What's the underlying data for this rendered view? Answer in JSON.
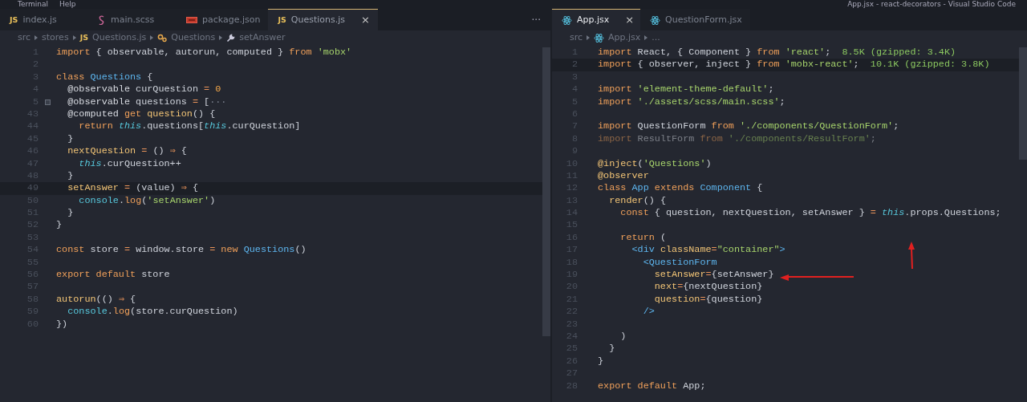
{
  "title_bar": {
    "menu": [
      "Terminal",
      "Help"
    ],
    "title": "App.jsx - react-decorators - Visual Studio Code"
  },
  "panes": [
    {
      "tabs": [
        {
          "label": "index.js",
          "kind": "js",
          "icon_text": "JS",
          "selected": false
        },
        {
          "label": "main.scss",
          "kind": "scss",
          "selected": false
        },
        {
          "label": "package.json",
          "kind": "json",
          "selected": false
        },
        {
          "label": "Questions.js",
          "kind": "js",
          "icon_text": "JS",
          "selected": true,
          "close": "×"
        }
      ],
      "more": "···",
      "breadcrumb": [
        {
          "label": "src"
        },
        {
          "label": "stores"
        },
        {
          "label": "Questions.js",
          "kind": "js",
          "icon_text": "JS"
        },
        {
          "label": "Questions",
          "kind": "class"
        },
        {
          "label": "setAnswer",
          "kind": "method"
        }
      ],
      "lines": [
        {
          "num": "1",
          "tokens": [
            {
              "text": "import",
              "kind": "k"
            },
            {
              "text": " { observable, autorun, computed } ",
              "kind": "v"
            },
            {
              "text": "from",
              "kind": "k"
            },
            {
              "text": " 'mobx'",
              "kind": "s"
            }
          ]
        },
        {
          "num": "2"
        },
        {
          "num": "3",
          "tokens": [
            {
              "text": "class",
              "kind": "k"
            },
            {
              "text": " Questions",
              "kind": "c"
            },
            {
              "text": " {",
              "kind": "v"
            }
          ]
        },
        {
          "num": "4",
          "tokens": [
            {
              "text": "  @observable",
              "kind": "d"
            },
            {
              "text": " curQuestion ",
              "kind": "v"
            },
            {
              "text": "=",
              "kind": "o"
            },
            {
              "text": " 0",
              "kind": "n"
            }
          ]
        },
        {
          "num": "5",
          "folded": true,
          "tokens": [
            {
              "text": "  @observable",
              "kind": "d"
            },
            {
              "text": " questions ",
              "kind": "v"
            },
            {
              "text": "=",
              "kind": "o"
            },
            {
              "text": " [",
              "kind": "v"
            },
            {
              "text": "···",
              "kind": "x"
            }
          ]
        },
        {
          "num": "43",
          "tokens": [
            {
              "text": "  @computed",
              "kind": "d"
            },
            {
              "text": " get",
              "kind": "k"
            },
            {
              "text": " question",
              "kind": "f"
            },
            {
              "text": "() {",
              "kind": "v"
            }
          ]
        },
        {
          "num": "44",
          "tokens": [
            {
              "text": "    return",
              "kind": "k"
            },
            {
              "text": " this",
              "kind": "t"
            },
            {
              "text": ".questions[",
              "kind": "v"
            },
            {
              "text": "this",
              "kind": "t"
            },
            {
              "text": ".curQuestion]",
              "kind": "v"
            }
          ]
        },
        {
          "num": "45",
          "tokens": [
            {
              "text": "  }",
              "kind": "v"
            }
          ]
        },
        {
          "num": "46",
          "tokens": [
            {
              "text": "  nextQuestion",
              "kind": "f"
            },
            {
              "text": " =",
              "kind": "o"
            },
            {
              "text": " () ",
              "kind": "v"
            },
            {
              "text": "⇒",
              "kind": "o"
            },
            {
              "text": " {",
              "kind": "v"
            }
          ]
        },
        {
          "num": "47",
          "tokens": [
            {
              "text": "    this",
              "kind": "t"
            },
            {
              "text": ".curQuestion++",
              "kind": "v"
            }
          ]
        },
        {
          "num": "48",
          "tokens": [
            {
              "text": "  }",
              "kind": "v"
            }
          ]
        },
        {
          "num": "49",
          "current": true,
          "tokens": [
            {
              "text": "  setAnswer",
              "kind": "f"
            },
            {
              "text": " =",
              "kind": "o"
            },
            {
              "text": " (value) ",
              "kind": "v"
            },
            {
              "text": "⇒",
              "kind": "o"
            },
            {
              "text": " {",
              "kind": "v"
            }
          ]
        },
        {
          "num": "50",
          "tokens": [
            {
              "text": "    console",
              "kind": "b"
            },
            {
              "text": ".",
              "kind": "v"
            },
            {
              "text": "log",
              "kind": "k"
            },
            {
              "text": "(",
              "kind": "v"
            },
            {
              "text": "'setAnswer'",
              "kind": "s"
            },
            {
              "text": ")",
              "kind": "v"
            }
          ]
        },
        {
          "num": "51",
          "tokens": [
            {
              "text": "  }",
              "kind": "v"
            }
          ]
        },
        {
          "num": "52",
          "tokens": [
            {
              "text": "}",
              "kind": "v"
            }
          ]
        },
        {
          "num": "53"
        },
        {
          "num": "54",
          "tokens": [
            {
              "text": "const",
              "kind": "k"
            },
            {
              "text": " store ",
              "kind": "v"
            },
            {
              "text": "=",
              "kind": "o"
            },
            {
              "text": " window.store ",
              "kind": "v"
            },
            {
              "text": "=",
              "kind": "o"
            },
            {
              "text": " new",
              "kind": "k"
            },
            {
              "text": " Questions",
              "kind": "c"
            },
            {
              "text": "()",
              "kind": "v"
            }
          ]
        },
        {
          "num": "55"
        },
        {
          "num": "56",
          "tokens": [
            {
              "text": "export default",
              "kind": "k"
            },
            {
              "text": " store",
              "kind": "v"
            }
          ]
        },
        {
          "num": "57"
        },
        {
          "num": "58",
          "tokens": [
            {
              "text": "autorun",
              "kind": "f"
            },
            {
              "text": "(() ",
              "kind": "v"
            },
            {
              "text": "⇒",
              "kind": "o"
            },
            {
              "text": " {",
              "kind": "v"
            }
          ]
        },
        {
          "num": "59",
          "tokens": [
            {
              "text": "  console",
              "kind": "b"
            },
            {
              "text": ".",
              "kind": "v"
            },
            {
              "text": "log",
              "kind": "k"
            },
            {
              "text": "(store.curQuestion)",
              "kind": "v"
            }
          ]
        },
        {
          "num": "60",
          "tokens": [
            {
              "text": "})",
              "kind": "v"
            }
          ]
        }
      ]
    },
    {
      "tabs": [
        {
          "label": "App.jsx",
          "kind": "react",
          "selected": true,
          "close": "×"
        },
        {
          "label": "QuestionForm.jsx",
          "kind": "react",
          "selected": false
        }
      ],
      "breadcrumb": [
        {
          "label": "src"
        },
        {
          "label": "App.jsx",
          "kind": "react"
        },
        {
          "label": "..."
        }
      ],
      "lines": [
        {
          "num": "1",
          "tokens": [
            {
              "text": "import",
              "kind": "k"
            },
            {
              "text": " React, { Component } ",
              "kind": "v"
            },
            {
              "text": "from",
              "kind": "k"
            },
            {
              "text": " 'react'",
              "kind": "s"
            },
            {
              "text": ";",
              "kind": "v"
            },
            {
              "text": "  8.5K (gzipped: 3.4K)",
              "kind": "g"
            }
          ]
        },
        {
          "num": "2",
          "current": true,
          "tokens": [
            {
              "text": "import",
              "kind": "k"
            },
            {
              "text": " { observer, inject } ",
              "kind": "v"
            },
            {
              "text": "from",
              "kind": "k"
            },
            {
              "text": " 'mobx-react'",
              "kind": "s"
            },
            {
              "text": ";",
              "kind": "v"
            },
            {
              "text": "  10.1K (gzipped: 3.8K)",
              "kind": "g"
            }
          ]
        },
        {
          "num": "3"
        },
        {
          "num": "4",
          "tokens": [
            {
              "text": "import",
              "kind": "k"
            },
            {
              "text": " 'element-theme-default'",
              "kind": "s"
            },
            {
              "text": ";",
              "kind": "v"
            }
          ]
        },
        {
          "num": "5",
          "tokens": [
            {
              "text": "import",
              "kind": "k"
            },
            {
              "text": " './assets/scss/main.scss'",
              "kind": "s"
            },
            {
              "text": ";",
              "kind": "v"
            }
          ]
        },
        {
          "num": "6"
        },
        {
          "num": "7",
          "tokens": [
            {
              "text": "import",
              "kind": "k"
            },
            {
              "text": " QuestionForm ",
              "kind": "v"
            },
            {
              "text": "from",
              "kind": "k"
            },
            {
              "text": " './components/QuestionForm'",
              "kind": "s"
            },
            {
              "text": ";",
              "kind": "v"
            }
          ]
        },
        {
          "num": "8",
          "dim": true,
          "tokens": [
            {
              "text": "import",
              "kind": "k"
            },
            {
              "text": " ResultForm ",
              "kind": "v"
            },
            {
              "text": "from",
              "kind": "k"
            },
            {
              "text": " './components/ResultForm'",
              "kind": "s"
            },
            {
              "text": ";",
              "kind": "v"
            }
          ]
        },
        {
          "num": "9"
        },
        {
          "num": "10",
          "tokens": [
            {
              "text": "@inject",
              "kind": "f"
            },
            {
              "text": "(",
              "kind": "v"
            },
            {
              "text": "'Questions'",
              "kind": "s"
            },
            {
              "text": ")",
              "kind": "v"
            }
          ]
        },
        {
          "num": "11",
          "tokens": [
            {
              "text": "@observer",
              "kind": "f"
            }
          ]
        },
        {
          "num": "12",
          "tokens": [
            {
              "text": "class",
              "kind": "k"
            },
            {
              "text": " App",
              "kind": "c"
            },
            {
              "text": " extends",
              "kind": "k"
            },
            {
              "text": " Component",
              "kind": "c"
            },
            {
              "text": " {",
              "kind": "v"
            }
          ]
        },
        {
          "num": "13",
          "tokens": [
            {
              "text": "  render",
              "kind": "f"
            },
            {
              "text": "() {",
              "kind": "v"
            }
          ]
        },
        {
          "num": "14",
          "tokens": [
            {
              "text": "    const",
              "kind": "k"
            },
            {
              "text": " { question, nextQuestion, setAnswer } ",
              "kind": "v"
            },
            {
              "text": "=",
              "kind": "o"
            },
            {
              "text": " this",
              "kind": "t"
            },
            {
              "text": ".props.Questions;",
              "kind": "v"
            }
          ]
        },
        {
          "num": "15"
        },
        {
          "num": "16",
          "tokens": [
            {
              "text": "    return",
              "kind": "k"
            },
            {
              "text": " (",
              "kind": "v"
            }
          ]
        },
        {
          "num": "17",
          "tokens": [
            {
              "text": "      <div",
              "kind": "c"
            },
            {
              "text": " className",
              "kind": "f"
            },
            {
              "text": "=",
              "kind": "o"
            },
            {
              "text": "\"container\"",
              "kind": "s"
            },
            {
              "text": ">",
              "kind": "c"
            }
          ]
        },
        {
          "num": "18",
          "tokens": [
            {
              "text": "        <QuestionForm",
              "kind": "c"
            }
          ]
        },
        {
          "num": "19",
          "tokens": [
            {
              "text": "          setAnswer",
              "kind": "f"
            },
            {
              "text": "=",
              "kind": "o"
            },
            {
              "text": "{setAnswer}",
              "kind": "v"
            }
          ]
        },
        {
          "num": "20",
          "tokens": [
            {
              "text": "          next",
              "kind": "f"
            },
            {
              "text": "=",
              "kind": "o"
            },
            {
              "text": "{nextQuestion}",
              "kind": "v"
            }
          ]
        },
        {
          "num": "21",
          "tokens": [
            {
              "text": "          question",
              "kind": "f"
            },
            {
              "text": "=",
              "kind": "o"
            },
            {
              "text": "{question}",
              "kind": "v"
            }
          ]
        },
        {
          "num": "22",
          "tokens": [
            {
              "text": "        />",
              "kind": "c"
            }
          ]
        },
        {
          "num": "23"
        },
        {
          "num": "24",
          "tokens": [
            {
              "text": "    )",
              "kind": "v"
            }
          ]
        },
        {
          "num": "25",
          "tokens": [
            {
              "text": "  }",
              "kind": "v"
            }
          ]
        },
        {
          "num": "26",
          "tokens": [
            {
              "text": "}",
              "kind": "v"
            }
          ]
        },
        {
          "num": "27"
        },
        {
          "num": "28",
          "tokens": [
            {
              "text": "export default",
              "kind": "k"
            },
            {
              "text": " App;",
              "kind": "v"
            }
          ]
        }
      ],
      "annotations": [
        {
          "kind": "arrow-up"
        },
        {
          "kind": "arrow-left"
        }
      ]
    }
  ]
}
